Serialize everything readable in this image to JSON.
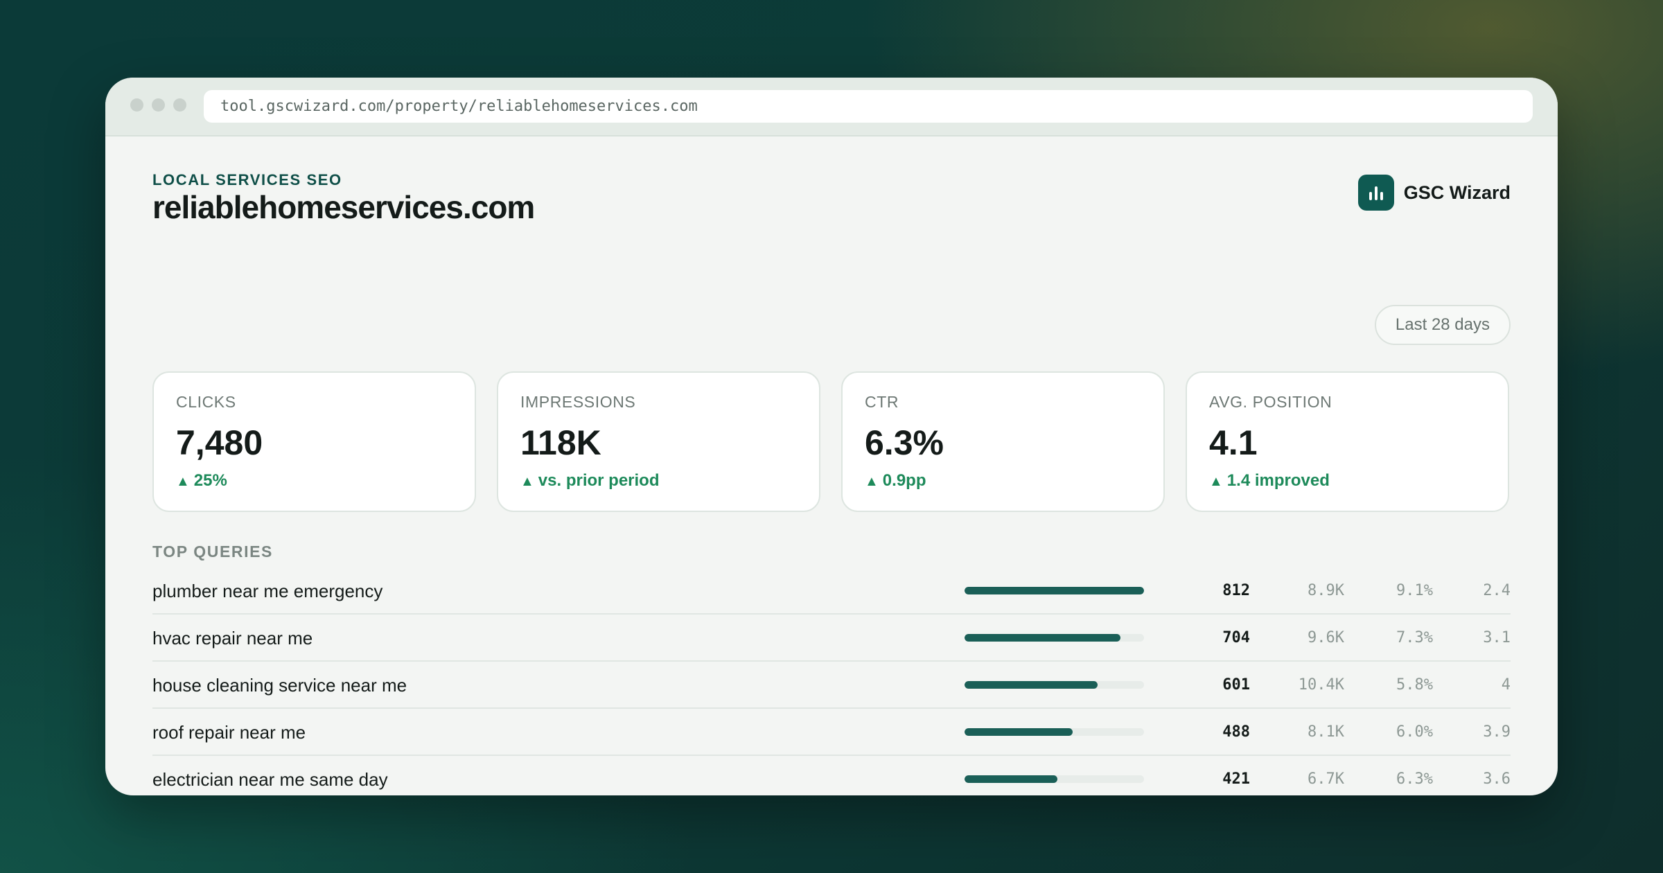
{
  "browser": {
    "url": "tool.gscwizard.com/property/reliablehomeservices.com"
  },
  "header": {
    "eyebrow": "LOCAL SERVICES SEO",
    "site": "reliablehomeservices.com",
    "brand": "GSC Wizard",
    "brand_icon": "bar-chart-icon",
    "date_range": "Last 28 days"
  },
  "colors": {
    "accent": "#0f5a52",
    "positive": "#1d8a5a",
    "bar": "#1a5f57",
    "bar_track": "#e7ece9"
  },
  "kpis": [
    {
      "label": "CLICKS",
      "value": "7,480",
      "delta": "25%"
    },
    {
      "label": "IMPRESSIONS",
      "value": "118K",
      "delta": "vs. prior period"
    },
    {
      "label": "CTR",
      "value": "6.3%",
      "delta": "0.9pp"
    },
    {
      "label": "AVG. POSITION",
      "value": "4.1",
      "delta": "1.4 improved"
    }
  ],
  "delta_icon": "▲",
  "queries_title": "TOP QUERIES",
  "queries": [
    {
      "query": "plumber near me emergency",
      "share": 1.0,
      "clicks": "812",
      "impressions": "8.9K",
      "ctr": "9.1%",
      "position": "2.4"
    },
    {
      "query": "hvac repair near me",
      "share": 0.867,
      "clicks": "704",
      "impressions": "9.6K",
      "ctr": "7.3%",
      "position": "3.1"
    },
    {
      "query": "house cleaning service near me",
      "share": 0.74,
      "clicks": "601",
      "impressions": "10.4K",
      "ctr": "5.8%",
      "position": "4"
    },
    {
      "query": "roof repair near me",
      "share": 0.601,
      "clicks": "488",
      "impressions": "8.1K",
      "ctr": "6.0%",
      "position": "3.9"
    },
    {
      "query": "electrician near me same day",
      "share": 0.518,
      "clicks": "421",
      "impressions": "6.7K",
      "ctr": "6.3%",
      "position": "3.6"
    }
  ]
}
